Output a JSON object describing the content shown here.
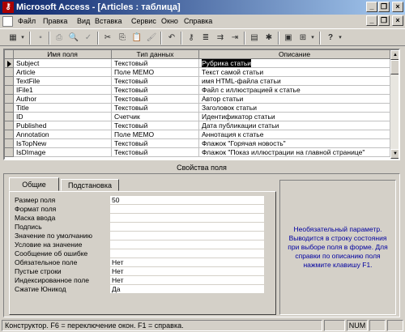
{
  "window": {
    "title": "Microsoft Access - [Articles : таблица]",
    "app_icon": "key-icon",
    "controls": {
      "minimize": "_",
      "restore": "❐",
      "close": "×"
    }
  },
  "menu": {
    "items": [
      "Файл",
      "Правка",
      "Вид",
      "Вставка",
      "Сервис",
      "Окно",
      "Справка"
    ]
  },
  "mdi_controls": {
    "minimize": "_",
    "restore": "❐",
    "close": "×"
  },
  "toolbar": {
    "icons": [
      {
        "name": "view-icon",
        "glyph": "▦",
        "enabled": true
      },
      {
        "name": "save-icon",
        "glyph": "▪",
        "enabled": false
      },
      {
        "name": "print-icon",
        "glyph": "⎙",
        "enabled": false
      },
      {
        "name": "preview-icon",
        "glyph": "🔍",
        "enabled": false
      },
      {
        "name": "spell-icon",
        "glyph": "✓",
        "enabled": false
      },
      {
        "name": "cut-icon",
        "glyph": "✂",
        "enabled": true
      },
      {
        "name": "copy-icon",
        "glyph": "⎘",
        "enabled": true
      },
      {
        "name": "paste-icon",
        "glyph": "📋",
        "enabled": true
      },
      {
        "name": "format-painter-icon",
        "glyph": "🖌",
        "enabled": false
      },
      {
        "name": "undo-icon",
        "glyph": "↶",
        "enabled": true
      },
      {
        "name": "primary-key-icon",
        "glyph": "⚷",
        "enabled": true
      },
      {
        "name": "indexes-icon",
        "glyph": "≣",
        "enabled": true
      },
      {
        "name": "insert-rows-icon",
        "glyph": "⇉",
        "enabled": true
      },
      {
        "name": "delete-rows-icon",
        "glyph": "⇥",
        "enabled": true
      },
      {
        "name": "properties-icon",
        "glyph": "▤",
        "enabled": true
      },
      {
        "name": "build-icon",
        "glyph": "✱",
        "enabled": true
      },
      {
        "name": "database-window-icon",
        "glyph": "▣",
        "enabled": true
      },
      {
        "name": "new-object-icon",
        "glyph": "⊞",
        "enabled": true
      },
      {
        "name": "help-icon",
        "glyph": "?",
        "enabled": true
      }
    ]
  },
  "grid": {
    "headers": [
      "Имя поля",
      "Тип данных",
      "Описание"
    ],
    "rows": [
      {
        "name": "Subject",
        "type": "Текстовый",
        "desc": "Рубрика статьи"
      },
      {
        "name": "Article",
        "type": "Поле МЕМО",
        "desc": "Текст самой статьи"
      },
      {
        "name": "TextFile",
        "type": "Текстовый",
        "desc": "имя HTML-файла статьи"
      },
      {
        "name": "IFile1",
        "type": "Текстовый",
        "desc": "Файл с иллюстрацией к статье"
      },
      {
        "name": "Author",
        "type": "Текстовый",
        "desc": "Автор статьи"
      },
      {
        "name": "Title",
        "type": "Текстовый",
        "desc": "Заголовок статьи"
      },
      {
        "name": "ID",
        "type": "Счетчик",
        "desc": "Идентификатор статьи"
      },
      {
        "name": "Published",
        "type": "Текстовый",
        "desc": "Дата публикации статьи"
      },
      {
        "name": "Annotation",
        "type": "Поле МЕМО",
        "desc": "Аннотация к статье"
      },
      {
        "name": "IsTopNew",
        "type": "Текстовый",
        "desc": "Флажок \"Горячая новость\""
      },
      {
        "name": "IsDImage",
        "type": "Текстовый",
        "desc": "Флажок \"Показ иллюстрации на главной странице\""
      },
      {
        "name": "",
        "type": "",
        "desc": ""
      }
    ]
  },
  "field_props": {
    "title": "Свойства поля",
    "tabs": [
      "Общие",
      "Подстановка"
    ],
    "rows": [
      {
        "label": "Размер поля",
        "value": "50"
      },
      {
        "label": "Формат поля",
        "value": ""
      },
      {
        "label": "Маска ввода",
        "value": ""
      },
      {
        "label": "Подпись",
        "value": ""
      },
      {
        "label": "Значение по умолчанию",
        "value": ""
      },
      {
        "label": "Условие на значение",
        "value": ""
      },
      {
        "label": "Сообщение об ошибке",
        "value": ""
      },
      {
        "label": "Обязательное поле",
        "value": "Нет"
      },
      {
        "label": "Пустые строки",
        "value": "Нет"
      },
      {
        "label": "Индексированное поле",
        "value": "Нет"
      },
      {
        "label": "Сжатие Юникод",
        "value": "Да"
      }
    ],
    "help": "Необязательный параметр. Выводится в строку состояния при выборе поля в форме. Для справки по описанию поля нажмите клавишу F1."
  },
  "status": {
    "text": "Конструктор. F6 = переключение окон. F1 = справка.",
    "num": "NUM"
  }
}
